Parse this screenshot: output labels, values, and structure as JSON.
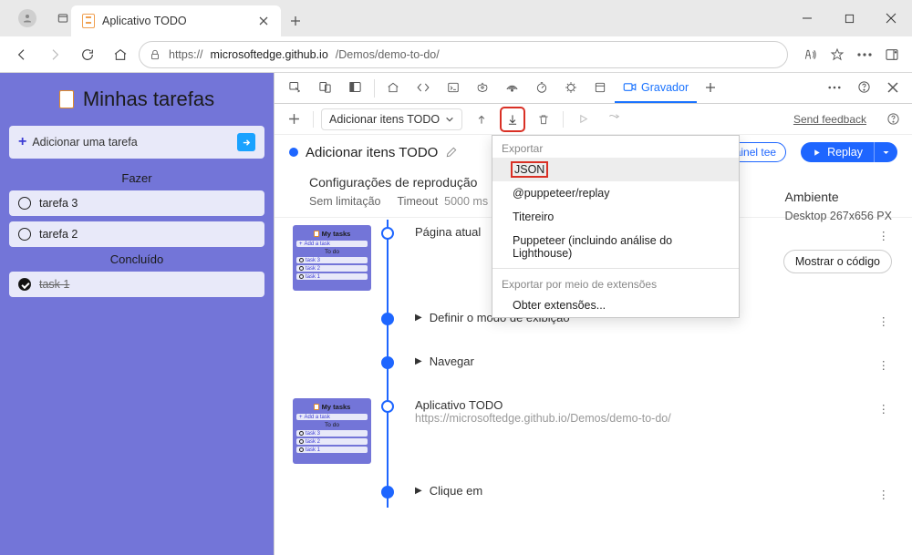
{
  "browser": {
    "tab_title": "Aplicativo TODO",
    "url_display_prefix": "https://",
    "url_display_host": "microsoftedge.github.io",
    "url_display_path": "/Demos/demo-to-do/"
  },
  "app": {
    "heading": "Minhas tarefas",
    "add_placeholder": "Adicionar uma tarefa",
    "groups": {
      "todo_label": "Fazer",
      "done_label": "Concluído"
    },
    "tasks_todo": [
      "tarefa 3",
      "tarefa 2"
    ],
    "tasks_done": [
      "task 1"
    ]
  },
  "devtools": {
    "tabs": {
      "recorder": "Gravador"
    },
    "controls": {
      "flow_name": "Adicionar itens TODO",
      "send_feedback": "Send feedback"
    },
    "header": {
      "title": "Adicionar itens TODO",
      "panel_tee": "painel tee",
      "replay_label": "Replay"
    },
    "playback": {
      "heading": "Configurações de reprodução",
      "limit": "Sem limitação",
      "timeout_label": "Timeout",
      "timeout_value": "5000 ms"
    },
    "env": {
      "heading": "Ambiente",
      "value": "Desktop 267x656 PX"
    },
    "show_code": "Mostrar o código",
    "steps": {
      "s0": "Página atual",
      "s1": "Definir o modo de exibição",
      "s2": "Navegar",
      "s3_title": "Aplicativo TODO",
      "s3_url": "https://microsoftedge.github.io/Demos/demo-to-do/",
      "s4": "Clique em"
    },
    "thumb": {
      "title": "My tasks",
      "add": "Add a task",
      "hdr": "To do",
      "t1": "task 3",
      "t2": "task 2",
      "t3": "task 1"
    },
    "export_menu": {
      "hdr1": "Exportar",
      "json": "JSON",
      "pupp_replay": "@puppeteer/replay",
      "titereiro": "Titereiro",
      "pupp_lh": "Puppeteer (incluindo análise do Lighthouse)",
      "hdr2": "Exportar por meio de extensões",
      "get_ext": "Obter extensões..."
    }
  }
}
